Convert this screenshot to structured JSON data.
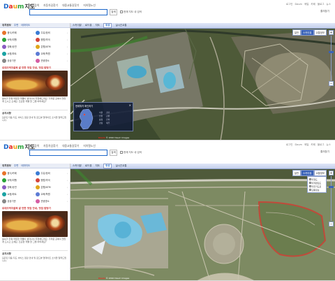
{
  "app": {
    "logo_letters": [
      "D",
      "a",
      "u",
      "m"
    ],
    "logo_title": "지도",
    "top_nav": [
      "지도검색",
      "자동차길찾기",
      "대중교통길찾기",
      "지하철노선"
    ],
    "utility": [
      "로그인",
      "Daum",
      "메일",
      "카페",
      "블로그",
      "뉴스"
    ],
    "search_placeholder": "",
    "search_button": "검색",
    "check_label": "현재 지도 내 검색",
    "right_link": "즐겨찾기"
  },
  "sidebar": {
    "head_tabs": [
      "위치정보",
      "주변",
      "테마지도"
    ],
    "categories": [
      {
        "label": "음식/카페",
        "color": "#e8742a"
      },
      {
        "label": "주유/정비",
        "color": "#3a7bd5"
      },
      {
        "label": "숙박/여행",
        "color": "#2aa33a"
      },
      {
        "label": "병원/약국",
        "color": "#d5443a"
      },
      {
        "label": "영화/공연",
        "color": "#8b5cc2"
      },
      {
        "label": "은행/ATM",
        "color": "#e0a61a"
      },
      {
        "label": "쇼핑/마트",
        "color": "#1aa3a3"
      },
      {
        "label": "교육/학원",
        "color": "#5c7bd5"
      },
      {
        "label": "공공기관",
        "color": "#888888"
      },
      {
        "label": "관광명소",
        "color": "#d55ca3"
      }
    ],
    "promo_title": "로데오먹자골목 갈 만한 맛집 안내, 맛집 탐방기",
    "promo_desc": "날씨가 추워 따뜻한 국물이 생각나서 추천해드려요. 가까운 곳에서 맛있게 드시고 오세요. 뜨끈한 국물 한 그릇 어떠세요?",
    "notice_head": "공지사항",
    "notice_body": "[공지] 다음 지도 서비스 점검 안내 및 로드뷰 업데이트 소식을 알려드립니다."
  },
  "map": {
    "tabs": [
      "스카이뷰",
      "로드뷰",
      "지도",
      "위성",
      "실시간교통"
    ],
    "active_tab": "위성",
    "map_types": [
      "일반",
      "스카이뷰",
      "교통정보"
    ],
    "selected_map_type": "스카이뷰",
    "copyright_brand": "Daum",
    "copyright_text": "© 2010 Daum Images"
  },
  "minimap": {
    "title": "현재위치 확인하기",
    "close": "×",
    "legend": [
      "서울",
      "경기",
      "인천",
      "강원",
      "충청",
      "전라",
      "경상",
      "제주"
    ]
  },
  "layer_panel": {
    "items": [
      "지형도",
      "지적편집도",
      "자전거도로",
      "교통정보"
    ]
  },
  "colors": {
    "brand_blue": "#1b66c9",
    "accent_red": "#e8271e"
  }
}
